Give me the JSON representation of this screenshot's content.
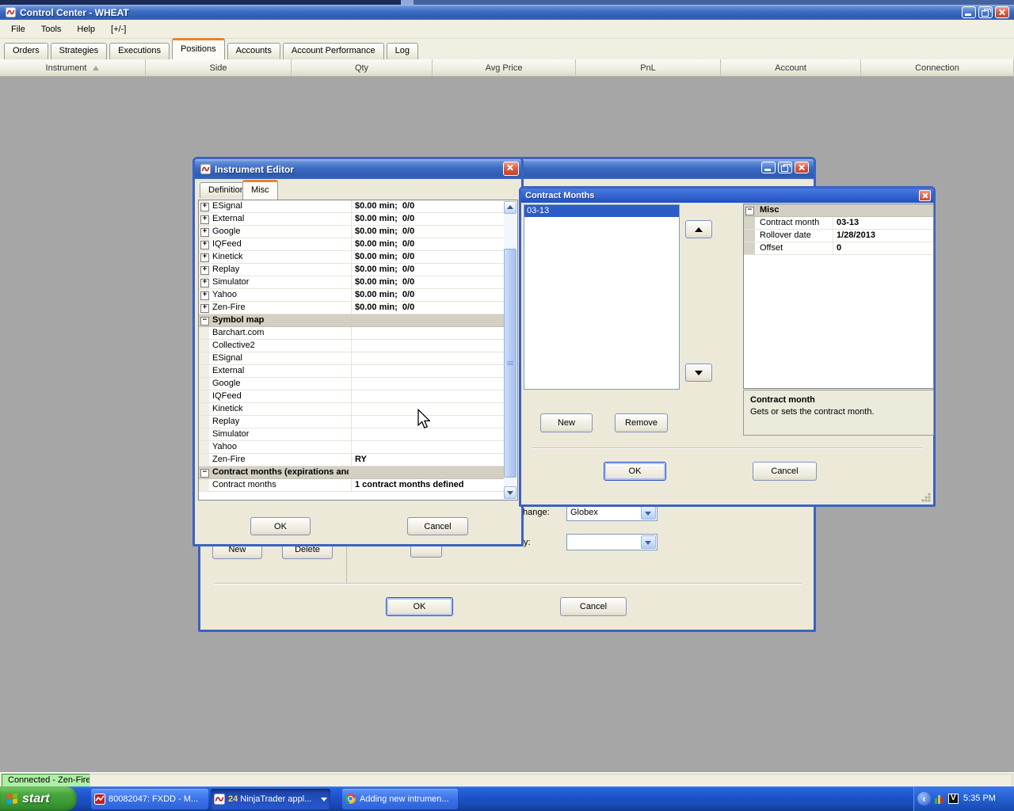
{
  "titlebar": {
    "title": "Control Center - WHEAT"
  },
  "menu": {
    "items": [
      "File",
      "Tools",
      "Help",
      "[+/-]"
    ]
  },
  "tabs": {
    "items": [
      "Orders",
      "Strategies",
      "Executions",
      "Positions",
      "Accounts",
      "Account Performance",
      "Log"
    ],
    "active": "Positions"
  },
  "table": {
    "headers": [
      "Instrument",
      "Side",
      "Qty",
      "Avg Price",
      "PnL",
      "Account",
      "Connection"
    ]
  },
  "statusbar": {
    "connection": "Connected - Zen-Fire"
  },
  "instrument_editor": {
    "title": "Instrument Editor",
    "tabs": [
      "Definition",
      "Misc"
    ],
    "active_tab": "Misc",
    "grid_rows": [
      {
        "name": "ESignal",
        "value": "$0.00 min;  0/0",
        "expand": "+"
      },
      {
        "name": "External",
        "value": "$0.00 min;  0/0",
        "expand": "+"
      },
      {
        "name": "Google",
        "value": "$0.00 min;  0/0",
        "expand": "+"
      },
      {
        "name": "IQFeed",
        "value": "$0.00 min;  0/0",
        "expand": "+"
      },
      {
        "name": "Kinetick",
        "value": "$0.00 min;  0/0",
        "expand": "+"
      },
      {
        "name": "Replay",
        "value": "$0.00 min;  0/0",
        "expand": "+"
      },
      {
        "name": "Simulator",
        "value": "$0.00 min;  0/0",
        "expand": "+"
      },
      {
        "name": "Yahoo",
        "value": "$0.00 min;  0/0",
        "expand": "+"
      },
      {
        "name": "Zen-Fire",
        "value": "$0.00 min;  0/0",
        "expand": "+"
      },
      {
        "name": "Symbol map",
        "category": true,
        "expand": "-"
      },
      {
        "name": "Barchart.com",
        "value": ""
      },
      {
        "name": "Collective2",
        "value": ""
      },
      {
        "name": "ESignal",
        "value": ""
      },
      {
        "name": "External",
        "value": ""
      },
      {
        "name": "Google",
        "value": ""
      },
      {
        "name": "IQFeed",
        "value": ""
      },
      {
        "name": "Kinetick",
        "value": ""
      },
      {
        "name": "Replay",
        "value": ""
      },
      {
        "name": "Simulator",
        "value": ""
      },
      {
        "name": "Yahoo",
        "value": ""
      },
      {
        "name": "Zen-Fire",
        "value": "RY"
      },
      {
        "name": "Contract months (expirations and",
        "category": true,
        "expand": "-"
      },
      {
        "name": "Contract months",
        "value": "1 contract months defined"
      }
    ],
    "ok": "OK",
    "cancel": "Cancel"
  },
  "contract_months": {
    "title": "Contract Months",
    "list_items": [
      "03-13"
    ],
    "selected_index": 0,
    "category": "Misc",
    "properties": [
      {
        "name": "Contract month",
        "value": "03-13"
      },
      {
        "name": "Rollover date",
        "value": "1/28/2013"
      },
      {
        "name": "Offset",
        "value": "0"
      }
    ],
    "description_title": "Contract month",
    "description_text": "Gets or sets the contract month.",
    "new": "New",
    "remove": "Remove",
    "ok": "OK",
    "cancel": "Cancel"
  },
  "background_dialog": {
    "exchange_label_visible": "hange:",
    "exchange_value": "Globex",
    "field2_label_visible": "y:",
    "new": "New",
    "delete": "Delete",
    "ok": "OK",
    "cancel": "Cancel"
  },
  "taskbar": {
    "start": "start",
    "tasks": [
      {
        "label": "80082047: FXDD - M...",
        "icon": "fxdd-icon",
        "active": false
      },
      {
        "label": "NinjaTrader appl...",
        "count": "24",
        "icon": "ninjatrader-icon",
        "active": true
      },
      {
        "label": "Adding new intrumen...",
        "icon": "chrome-icon",
        "active": false
      }
    ],
    "clock": "5:35 PM"
  },
  "colors": {
    "accent_orange": "#e5832a",
    "selection_blue": "#2c5cc5",
    "status_green": "#aeefa5",
    "dialog_border_blue": "#3c62c2"
  }
}
